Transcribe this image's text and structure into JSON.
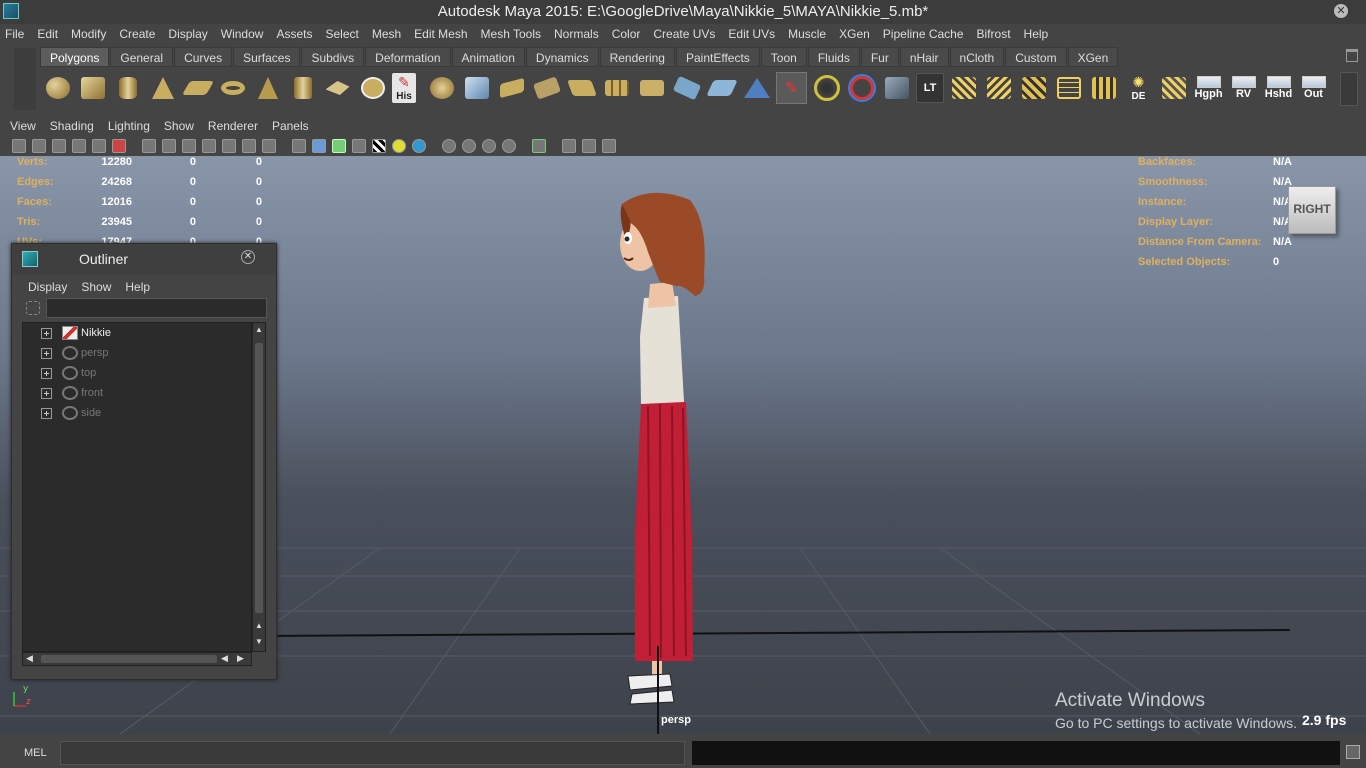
{
  "title": "Autodesk Maya 2015: E:\\GoogleDrive\\Maya\\Nikkie_5\\MAYA\\Nikkie_5.mb*",
  "main_menu": [
    "File",
    "Edit",
    "Modify",
    "Create",
    "Display",
    "Window",
    "Assets",
    "Select",
    "Mesh",
    "Edit Mesh",
    "Mesh Tools",
    "Normals",
    "Color",
    "Create UVs",
    "Edit UVs",
    "Muscle",
    "XGen",
    "Pipeline Cache",
    "Bifrost",
    "Help"
  ],
  "shelf_tabs": [
    "Polygons",
    "General",
    "Curves",
    "Surfaces",
    "Subdivs",
    "Deformation",
    "Animation",
    "Dynamics",
    "Rendering",
    "PaintEffects",
    "Toon",
    "Fluids",
    "Fur",
    "nHair",
    "nCloth",
    "Custom",
    "XGen"
  ],
  "shelf_active_tab": "Polygons",
  "shelf_labels": {
    "history": "His",
    "lt": "LT",
    "de": "DE",
    "hgph": "Hgph",
    "rv": "RV",
    "hshd": "Hshd",
    "out": "Out"
  },
  "panel_menu": [
    "View",
    "Shading",
    "Lighting",
    "Show",
    "Renderer",
    "Panels"
  ],
  "hud_left": [
    {
      "label": "Verts:",
      "a": "12280",
      "b": "0",
      "c": "0"
    },
    {
      "label": "Edges:",
      "a": "24268",
      "b": "0",
      "c": "0"
    },
    {
      "label": "Faces:",
      "a": "12016",
      "b": "0",
      "c": "0"
    },
    {
      "label": "Tris:",
      "a": "23945",
      "b": "0",
      "c": "0"
    },
    {
      "label": "UVs:",
      "a": "17947",
      "b": "0",
      "c": "0"
    }
  ],
  "hud_right": [
    {
      "label": "Backfaces:",
      "value": "N/A"
    },
    {
      "label": "Smoothness:",
      "value": "N/A"
    },
    {
      "label": "Instance:",
      "value": "N/A"
    },
    {
      "label": "Display Layer:",
      "value": "N/A"
    },
    {
      "label": "Distance From Camera:",
      "value": "N/A"
    },
    {
      "label": "Selected Objects:",
      "value": "0"
    }
  ],
  "viewcube_label": "RIGHT",
  "camera_name": "persp",
  "fps": "2.9 fps",
  "activate_windows": {
    "line1": "Activate Windows",
    "line2": "Go to PC settings to activate Windows."
  },
  "outliner": {
    "title": "Outliner",
    "menu": [
      "Display",
      "Show",
      "Help"
    ],
    "search_value": "",
    "items": [
      {
        "label": "Nikkie",
        "type": "mesh",
        "dim": false
      },
      {
        "label": "persp",
        "type": "camera",
        "dim": true
      },
      {
        "label": "top",
        "type": "camera",
        "dim": true
      },
      {
        "label": "front",
        "type": "camera",
        "dim": true
      },
      {
        "label": "side",
        "type": "camera",
        "dim": true
      }
    ]
  },
  "axis": {
    "y": "y",
    "z": "z"
  },
  "command_line": {
    "mode": "MEL",
    "value": ""
  },
  "colors": {
    "hud_label": "#e0b05e",
    "hair": "#9a4a26",
    "skirt": "#c11f35",
    "top": "#e6e1d6",
    "skin": "#efc4a6"
  }
}
